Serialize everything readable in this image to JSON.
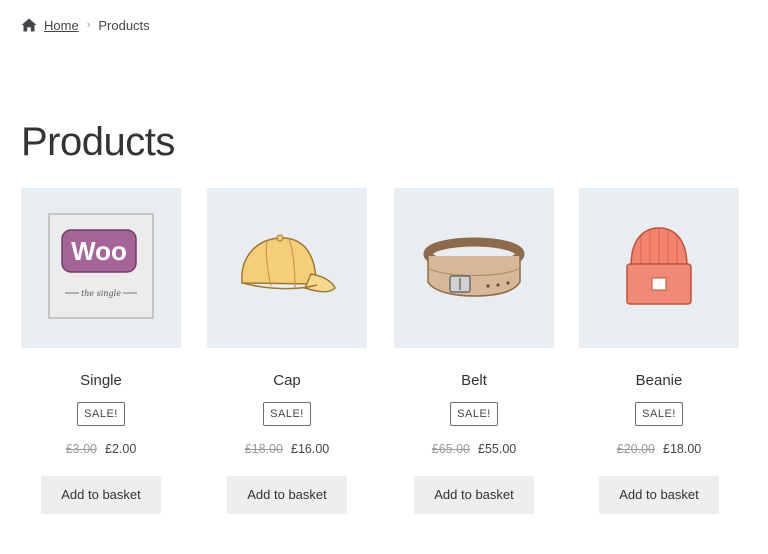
{
  "breadcrumb": {
    "home_label": "Home",
    "current_label": "Products"
  },
  "page_title": "Products",
  "products": [
    {
      "name": "Single",
      "badge": "SALE!",
      "old_price": "£3.00",
      "price": "£2.00",
      "button": "Add to basket",
      "image_icon": "woo-single-album-icon",
      "logo_text": "Woo",
      "caption_text": "the single"
    },
    {
      "name": "Cap",
      "badge": "SALE!",
      "old_price": "£18.00",
      "price": "£16.00",
      "button": "Add to basket",
      "image_icon": "cap-icon"
    },
    {
      "name": "Belt",
      "badge": "SALE!",
      "old_price": "£65.00",
      "price": "£55.00",
      "button": "Add to basket",
      "image_icon": "belt-icon"
    },
    {
      "name": "Beanie",
      "badge": "SALE!",
      "old_price": "£20.00",
      "price": "£18.00",
      "button": "Add to basket",
      "image_icon": "beanie-icon"
    }
  ],
  "colors": {
    "thumb_bg": "#e8edf2",
    "button_bg": "#eeeeee",
    "woo_purple": "#a46497"
  }
}
